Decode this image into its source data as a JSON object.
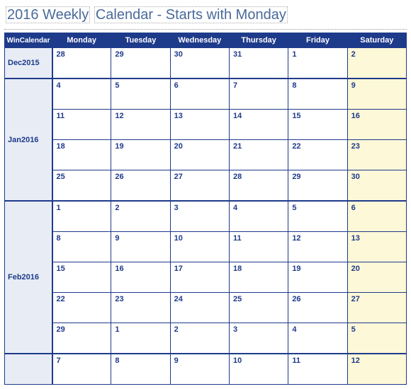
{
  "title_parts": [
    "2016 Weekly",
    "Calendar - Starts with Monday"
  ],
  "corner_label": "WinCalendar",
  "day_headers": [
    "Monday",
    "Tuesday",
    "Wednesday",
    "Thursday",
    "Friday",
    "Saturday"
  ],
  "months": [
    {
      "label": "Dec2015",
      "rows": [
        [
          "28",
          "29",
          "30",
          "31",
          "1",
          "2"
        ]
      ]
    },
    {
      "label": "Jan2016",
      "rows": [
        [
          "4",
          "5",
          "6",
          "7",
          "8",
          "9"
        ],
        [
          "11",
          "12",
          "13",
          "14",
          "15",
          "16"
        ],
        [
          "18",
          "19",
          "20",
          "21",
          "22",
          "23"
        ],
        [
          "25",
          "26",
          "27",
          "28",
          "29",
          "30"
        ]
      ]
    },
    {
      "label": "Feb2016",
      "rows": [
        [
          "1",
          "2",
          "3",
          "4",
          "5",
          "6"
        ],
        [
          "8",
          "9",
          "10",
          "11",
          "12",
          "13"
        ],
        [
          "15",
          "16",
          "17",
          "18",
          "19",
          "20"
        ],
        [
          "22",
          "23",
          "24",
          "25",
          "26",
          "27"
        ],
        [
          "29",
          "1",
          "2",
          "3",
          "4",
          "5"
        ]
      ]
    },
    {
      "label": "",
      "rows": [
        [
          "7",
          "8",
          "9",
          "10",
          "11",
          "12"
        ]
      ]
    }
  ]
}
